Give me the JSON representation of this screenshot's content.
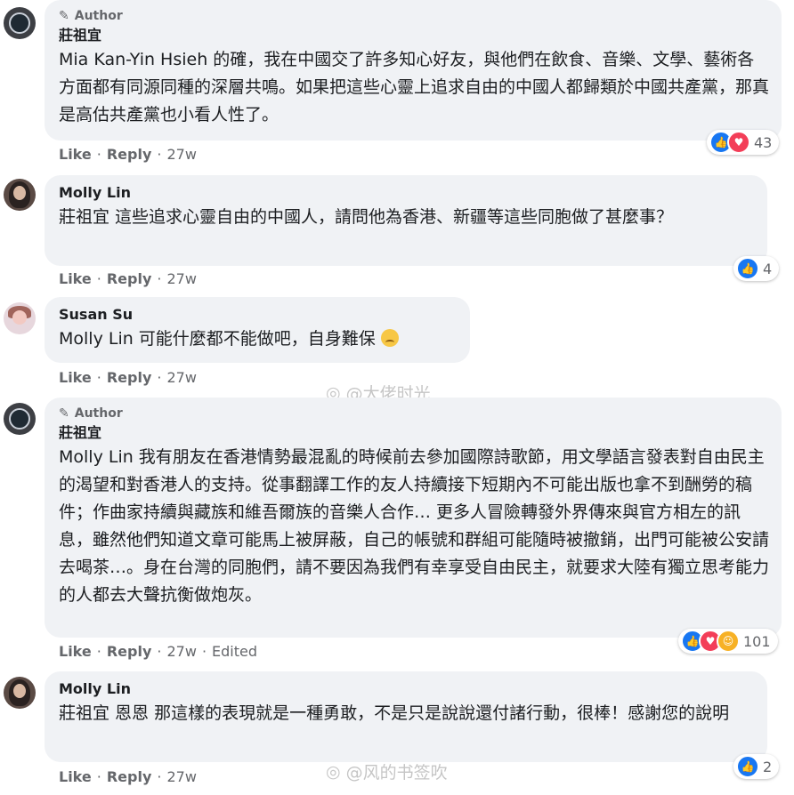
{
  "colors": {
    "like": "#1877f2",
    "love": "#f33e58",
    "haha": "#f7b125",
    "bubble": "#f0f2f5",
    "meta": "#65676b"
  },
  "comments": [
    {
      "author_badge": "Author",
      "name": "莊祖宜",
      "tag": "Mia Kan-Yin Hsieh",
      "body": " 的確，我在中國交了許多知心好友，與他們在飲食、音樂、文學、藝術各方面都有同源同種的深層共鳴。如果把這些心靈上追求自由的中國人都歸類於中國共產黨，那真是高估共產黨也小看人性了。",
      "like": "Like",
      "reply": "Reply",
      "time": "27w",
      "edited": "",
      "reaction_count": "43"
    },
    {
      "author_badge": "",
      "name": "Molly Lin",
      "tag": "莊祖宜",
      "body": " 這些追求心靈自由的中國人，請問他為香港、新疆等這些同胞做了甚麼事？",
      "like": "Like",
      "reply": "Reply",
      "time": "27w",
      "edited": "",
      "reaction_count": "4"
    },
    {
      "author_badge": "",
      "name": "Susan Su",
      "tag": "Molly Lin",
      "body": " 可能什麼都不能做吧，自身難保",
      "like": "Like",
      "reply": "Reply",
      "time": "27w",
      "edited": "",
      "reaction_count": ""
    },
    {
      "author_badge": "Author",
      "name": "莊祖宜",
      "tag": "Molly Lin",
      "body": " 我有朋友在香港情勢最混亂的時候前去參加國際詩歌節，用文學語言發表對自由民主的渴望和對香港人的支持。從事翻譯工作的友人持續接下短期內不可能出版也拿不到酬勞的稿件；作曲家持續與藏族和維吾爾族的音樂人合作… 更多人冒險轉發外界傳來與官方相左的訊息，雖然他們知道文章可能馬上被屏蔽，自己的帳號和群組可能隨時被撤銷，出門可能被公安請去喝茶…。身在台灣的同胞們，請不要因為我們有幸享受自由民主，就要求大陸有獨立思考能力的人都去大聲抗衡做炮灰。",
      "like": "Like",
      "reply": "Reply",
      "time": "27w",
      "edited": "Edited",
      "reaction_count": "101"
    },
    {
      "author_badge": "",
      "name": "Molly Lin",
      "tag": "莊祖宜",
      "body": " 恩恩 那這樣的表現就是一種勇敢，不是只是說說還付諸行動，很棒！感謝您的說明",
      "like": "Like",
      "reply": "Reply",
      "time": "27w",
      "edited": "",
      "reaction_count": "2"
    }
  ],
  "watermarks": [
    "@大佬时光",
    "@风的书签吹"
  ]
}
